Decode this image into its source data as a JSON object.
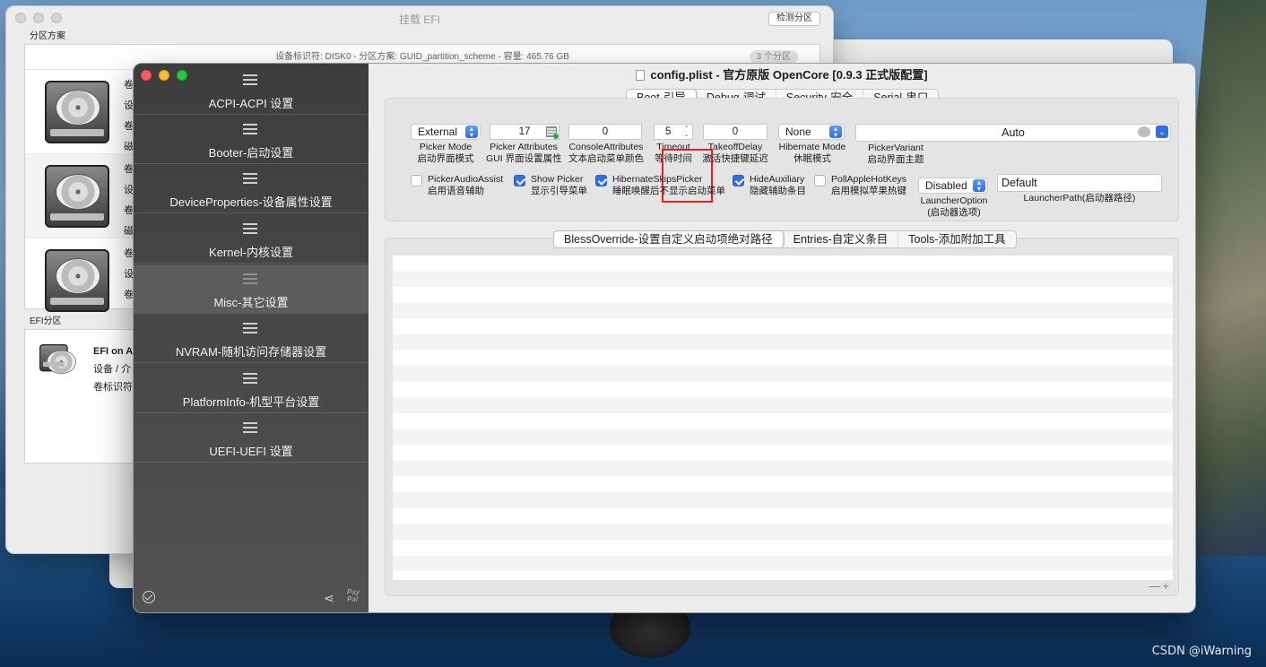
{
  "efi_window": {
    "title": "挂载 EFI",
    "detect_button": "检测分区",
    "partition_section": "分区方案",
    "disk_info": "设备标识符: DISK0 - 分区方案: GUID_partition_scheme - 容量: 465.76 GB",
    "partition_count": "3 个分区",
    "rows": [
      {
        "lines": [
          "卷",
          "设",
          "卷",
          "磁"
        ]
      },
      {
        "lines": [
          "卷",
          "设",
          "卷",
          "磁"
        ]
      },
      {
        "lines": [
          "卷",
          "设",
          "卷"
        ]
      }
    ],
    "efi_section": "EFI分区",
    "efi_item": {
      "title": "EFI on A",
      "line2": "设备 / 介",
      "line3": "卷标识符"
    }
  },
  "config_window": {
    "title": "config.plist - 官方原版 OpenCore [0.9.3 正式版配置]",
    "sidebar": [
      {
        "label": "ACPI-ACPI 设置",
        "icon": "list-icon"
      },
      {
        "label": "Booter-启动设置",
        "icon": "list-icon"
      },
      {
        "label": "DeviceProperties-设备属性设置",
        "icon": "list-icon"
      },
      {
        "label": "Kernel-内核设置",
        "icon": "list-icon"
      },
      {
        "label": "Misc-其它设置",
        "icon": "list-icon",
        "selected": true
      },
      {
        "label": "NVRAM-随机访问存储器设置",
        "icon": "list-icon"
      },
      {
        "label": "PlatformInfo-机型平台设置",
        "icon": "list-icon"
      },
      {
        "label": "UEFI-UEFI 设置",
        "icon": "list-icon"
      }
    ],
    "footer": {
      "paypal_line1": "Pay",
      "paypal_line2": "Pal"
    },
    "tabs": [
      "Boot-引导",
      "Debug-调试",
      "Security-安全",
      "Serial-串口"
    ],
    "active_tab": "Boot-引导",
    "boot": {
      "picker_mode": {
        "value": "External",
        "label_en": "Picker Mode",
        "label_zh": "启动界面模式"
      },
      "picker_attributes": {
        "value": "17",
        "label_en": "Picker Attributes",
        "label_zh": "GUI 界面设置属性"
      },
      "console_attributes": {
        "value": "0",
        "label_en": "ConsoleAttributes",
        "label_zh": "文本启动菜单颜色"
      },
      "timeout": {
        "value": "5",
        "label_en": "Timeout",
        "label_zh": "等待时间"
      },
      "takeoff_delay": {
        "value": "0",
        "label_en": "TakeoffDelay",
        "label_zh": "激活快捷键延迟"
      },
      "hibernate_mode": {
        "value": "None",
        "label_en": "Hibernate Mode",
        "label_zh": "休眠模式"
      },
      "picker_variant": {
        "value": "Auto",
        "label_en": "PickerVariant",
        "label_zh": "启动界面主题"
      },
      "checkboxes": [
        {
          "label_en": "PickerAudioAssist",
          "label_zh": "启用语音辅助",
          "checked": false
        },
        {
          "label_en": "Show Picker",
          "label_zh": "显示引导菜单",
          "checked": true
        },
        {
          "label_en": "HibernateSkipsPicker",
          "label_zh": "睡眠唤醒后不显示启动菜单",
          "checked": true
        },
        {
          "label_en": "HideAuxiliary",
          "label_zh": "隐藏辅助条目",
          "checked": true
        },
        {
          "label_en": "PollAppleHotKeys",
          "label_zh": "启用模拟苹果热键",
          "checked": false
        }
      ],
      "launcher_option": {
        "value": "Disabled",
        "label_en": "LauncherOption",
        "label_zh": "(启动器选项)"
      },
      "launcher_path": {
        "value": "Default",
        "label": "LauncherPath(启动器路径)"
      }
    },
    "sub_tabs": [
      "BlessOverride-设置自定义启动项绝对路径",
      "Entries-自定义条目",
      "Tools-添加附加工具"
    ],
    "active_sub_tab": "BlessOverride-设置自定义启动项绝对路径",
    "table_controls": {
      "remove": "—",
      "add": "+"
    }
  },
  "watermark": "CSDN @iWarning",
  "colors": {
    "highlight": "#e8221b",
    "accent": "#2f6fe4"
  }
}
